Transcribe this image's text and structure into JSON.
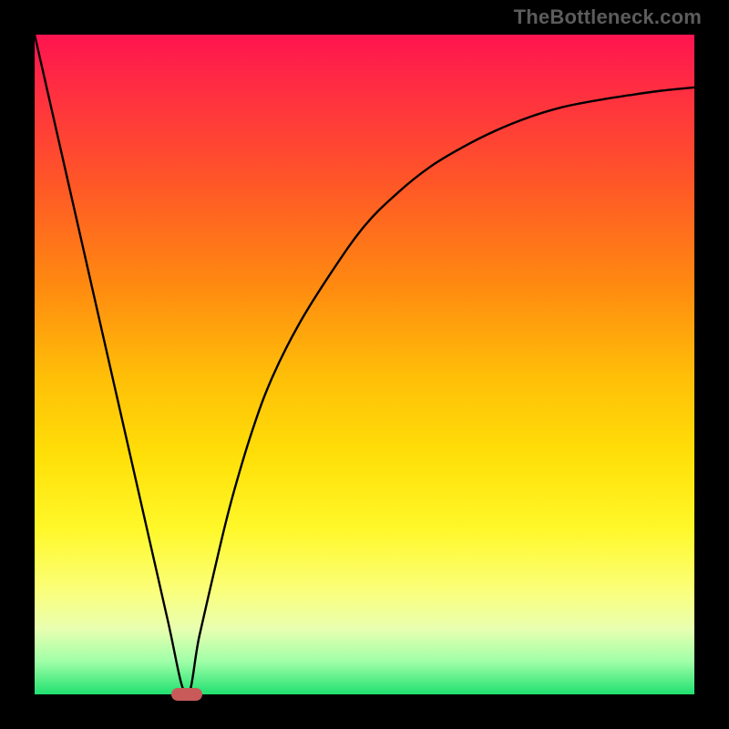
{
  "watermark": "TheBottleneck.com",
  "colors": {
    "frame": "#000000",
    "gradient_top": "#ff1450",
    "gradient_bottom": "#20e070",
    "curve": "#000000",
    "marker": "#c95a5a",
    "watermark_text": "#5c5c5c"
  },
  "chart_data": {
    "type": "line",
    "title": "",
    "xlabel": "",
    "ylabel": "",
    "xlim": [
      0,
      100
    ],
    "ylim": [
      0,
      100
    ],
    "grid": false,
    "legend_position": "none",
    "series": [
      {
        "name": "bottleneck-curve",
        "x": [
          0,
          5,
          10,
          15,
          20,
          23,
          25,
          28,
          30,
          33,
          36,
          40,
          45,
          50,
          55,
          60,
          65,
          70,
          75,
          80,
          85,
          90,
          95,
          100
        ],
        "values": [
          100,
          78,
          56,
          34,
          12,
          0,
          9,
          22,
          30,
          40,
          48,
          56,
          64,
          71,
          76,
          80,
          83,
          85.5,
          87.5,
          89,
          90,
          90.8,
          91.5,
          92
        ]
      }
    ],
    "annotations": [
      {
        "name": "optimal-marker",
        "x": 23,
        "y": 0
      }
    ],
    "notes": "V-shaped bottleneck curve on a vertical red-to-green gradient; minimum (y=0) near x≈23; right arm asymptotically approaches ~92."
  }
}
